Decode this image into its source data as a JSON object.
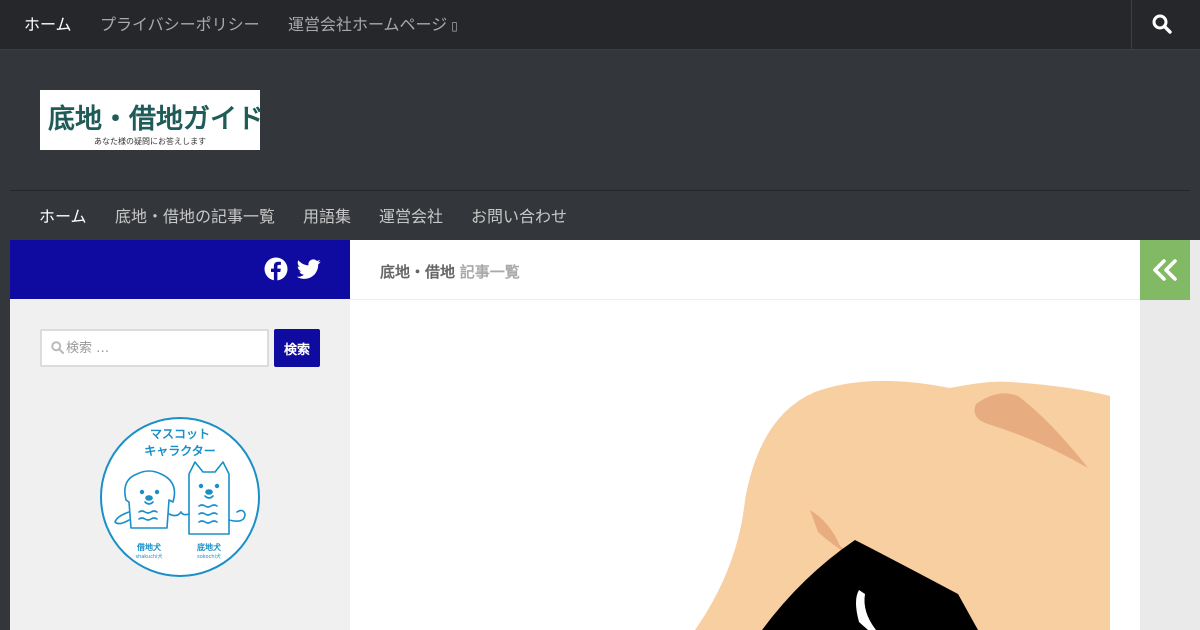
{
  "top_nav": {
    "items": [
      {
        "label": "ホーム",
        "active": true
      },
      {
        "label": "プライバシーポリシー",
        "active": false
      },
      {
        "label": "運営会社ホームページ",
        "active": false
      }
    ],
    "external_icon": "external-link-icon",
    "search_icon": "search-icon"
  },
  "logo": {
    "title": "底地・借地ガイド",
    "tagline": "あなた様の疑問にお答えします"
  },
  "main_nav": {
    "items": [
      {
        "label": "ホーム",
        "active": true
      },
      {
        "label": "底地・借地の記事一覧",
        "active": false
      },
      {
        "label": "用語集",
        "active": false
      },
      {
        "label": "運営会社",
        "active": false
      },
      {
        "label": "お問い合わせ",
        "active": false
      }
    ]
  },
  "social": [
    "facebook-icon",
    "twitter-icon"
  ],
  "sidebar": {
    "search_placeholder": "検索 …",
    "search_button": "検索",
    "mascot": {
      "heading_line1": "マスコット",
      "heading_line2": "キャラクター",
      "left_name": "借地犬",
      "left_romaji": "shakuchi犬",
      "right_name": "底地犬",
      "right_romaji": "sokochi犬"
    }
  },
  "content": {
    "heading_strong": "底地・借地",
    "heading_light": "記事一覧"
  },
  "colors": {
    "accent_blue": "#0f0aa0",
    "accent_green": "#82b965",
    "dark_bg": "#33363b",
    "logo_text": "#1f5b57",
    "mascot_line": "#1a8fc8"
  }
}
